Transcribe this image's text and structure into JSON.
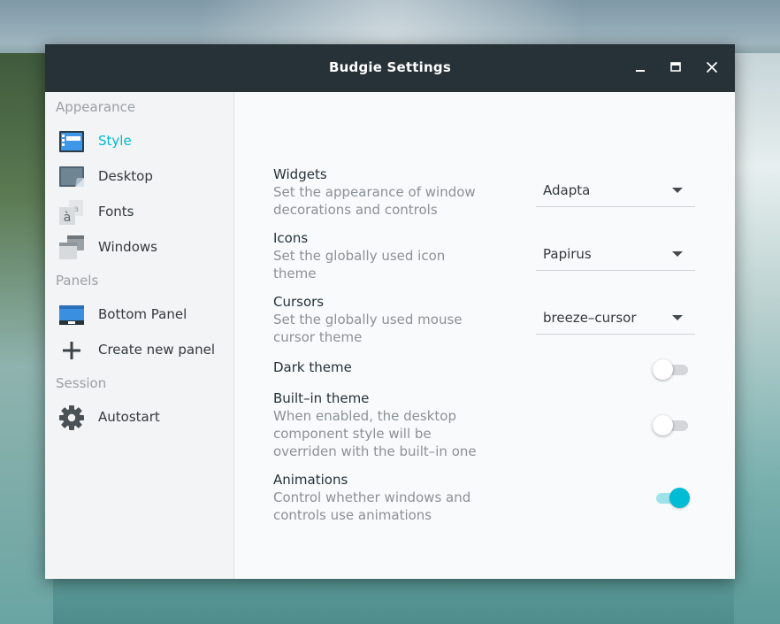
{
  "window": {
    "title": "Budgie Settings"
  },
  "sidebar": {
    "sections": [
      {
        "heading": "Appearance",
        "items": [
          {
            "label": "Style",
            "icon": "style-icon",
            "active": true
          },
          {
            "label": "Desktop",
            "icon": "desktop-icon"
          },
          {
            "label": "Fonts",
            "icon": "fonts-icon"
          },
          {
            "label": "Windows",
            "icon": "windows-icon"
          }
        ]
      },
      {
        "heading": "Panels",
        "items": [
          {
            "label": "Bottom Panel",
            "icon": "panel-icon"
          },
          {
            "label": "Create new panel",
            "icon": "plus-icon"
          }
        ]
      },
      {
        "heading": "Session",
        "items": [
          {
            "label": "Autostart",
            "icon": "gear-icon"
          }
        ]
      }
    ]
  },
  "settings": {
    "widgets": {
      "title": "Widgets",
      "desc": "Set the appearance of window decorations and controls",
      "value": "Adapta"
    },
    "icons": {
      "title": "Icons",
      "desc": "Set the globally used icon theme",
      "value": "Papirus"
    },
    "cursors": {
      "title": "Cursors",
      "desc": "Set the globally used mouse cursor theme",
      "value": "breeze–cursor"
    },
    "dark_theme": {
      "title": "Dark theme",
      "enabled": false
    },
    "builtin_theme": {
      "title": "Built–in theme",
      "desc": "When enabled, the desktop component style will be overriden with the built–in one",
      "enabled": false
    },
    "animations": {
      "title": "Animations",
      "desc": "Control whether windows and controls use animations",
      "enabled": true
    }
  },
  "colors": {
    "titlebar": "#263238",
    "accent": "#00bcd4",
    "sidebar_bg": "#f3f4f5",
    "content_bg": "#f9fafb"
  }
}
